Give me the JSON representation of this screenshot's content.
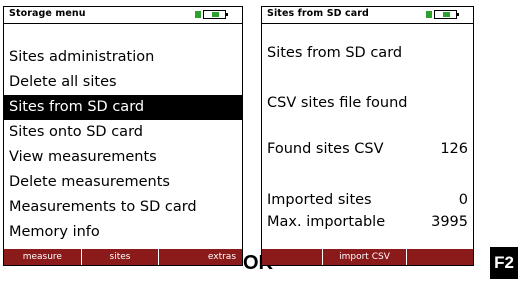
{
  "left_screen": {
    "title": "Storage menu",
    "menu": [
      {
        "label": "Sites administration"
      },
      {
        "label": "Delete all sites"
      },
      {
        "label": "Sites from SD card"
      },
      {
        "label": "Sites onto SD card"
      },
      {
        "label": "View measurements"
      },
      {
        "label": "Delete measurements"
      },
      {
        "label": "Measurements to SD card"
      },
      {
        "label": "Memory info"
      }
    ],
    "selected_item": "Sites from SD card",
    "softkeys": {
      "left": "measure",
      "middle": "sites",
      "right": "extras"
    }
  },
  "right_screen": {
    "title": "Sites from SD card",
    "heading": "Sites from SD card",
    "status": "CSV sites file found",
    "found_label": "Found sites CSV",
    "found_value": "126",
    "imported_label": "Imported sites",
    "imported_value": "0",
    "max_label": "Max. importable",
    "max_value": "3995",
    "softkeys": {
      "left": "",
      "middle": "import CSV",
      "right": ""
    }
  },
  "keys": {
    "ok": "OK",
    "f2": "F2"
  },
  "colors": {
    "softkey_bar": "#8b1a1a",
    "battery": "#2ea02e",
    "selection": "#000000"
  }
}
